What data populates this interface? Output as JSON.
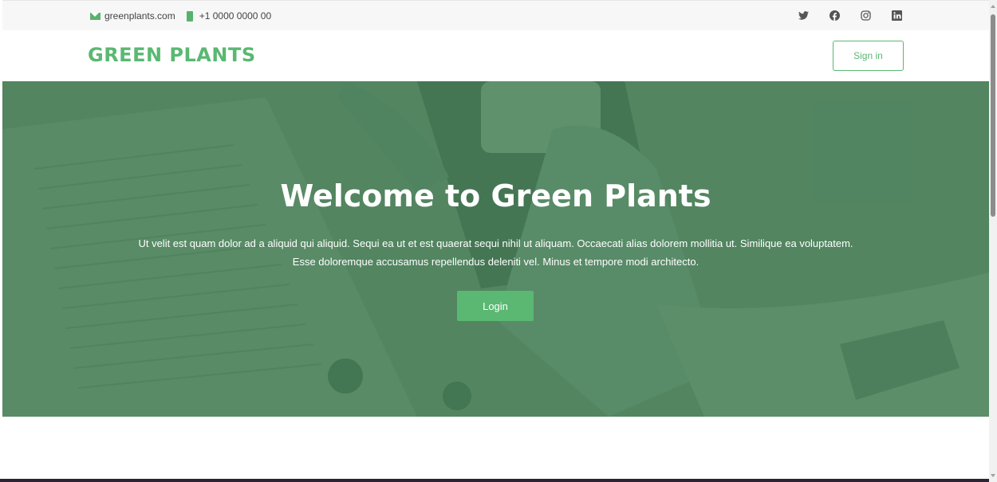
{
  "topbar": {
    "email": "greenplants.com",
    "phone": "+1 0000 0000 00",
    "social": [
      "twitter-icon",
      "facebook-icon",
      "instagram-icon",
      "linkedin-icon"
    ]
  },
  "navbar": {
    "brand": "GREEN PLANTS",
    "signin_label": "Sign in"
  },
  "hero": {
    "title": "Welcome to Green Plants",
    "text_line1": "Ut velit est quam dolor ad a aliquid qui aliquid. Sequi ea ut et est quaerat sequi nihil ut aliquam. Occaecati alias dolorem mollitia ut. Similique ea voluptatem.",
    "text_line2": "Esse doloremque accusamus repellendus deleniti vel. Minus et tempore modi architecto.",
    "button_label": "Login"
  },
  "colors": {
    "accent": "#5ab872",
    "hero_overlay": "#4f7f60",
    "topbar_bg": "#f7f7f7"
  }
}
